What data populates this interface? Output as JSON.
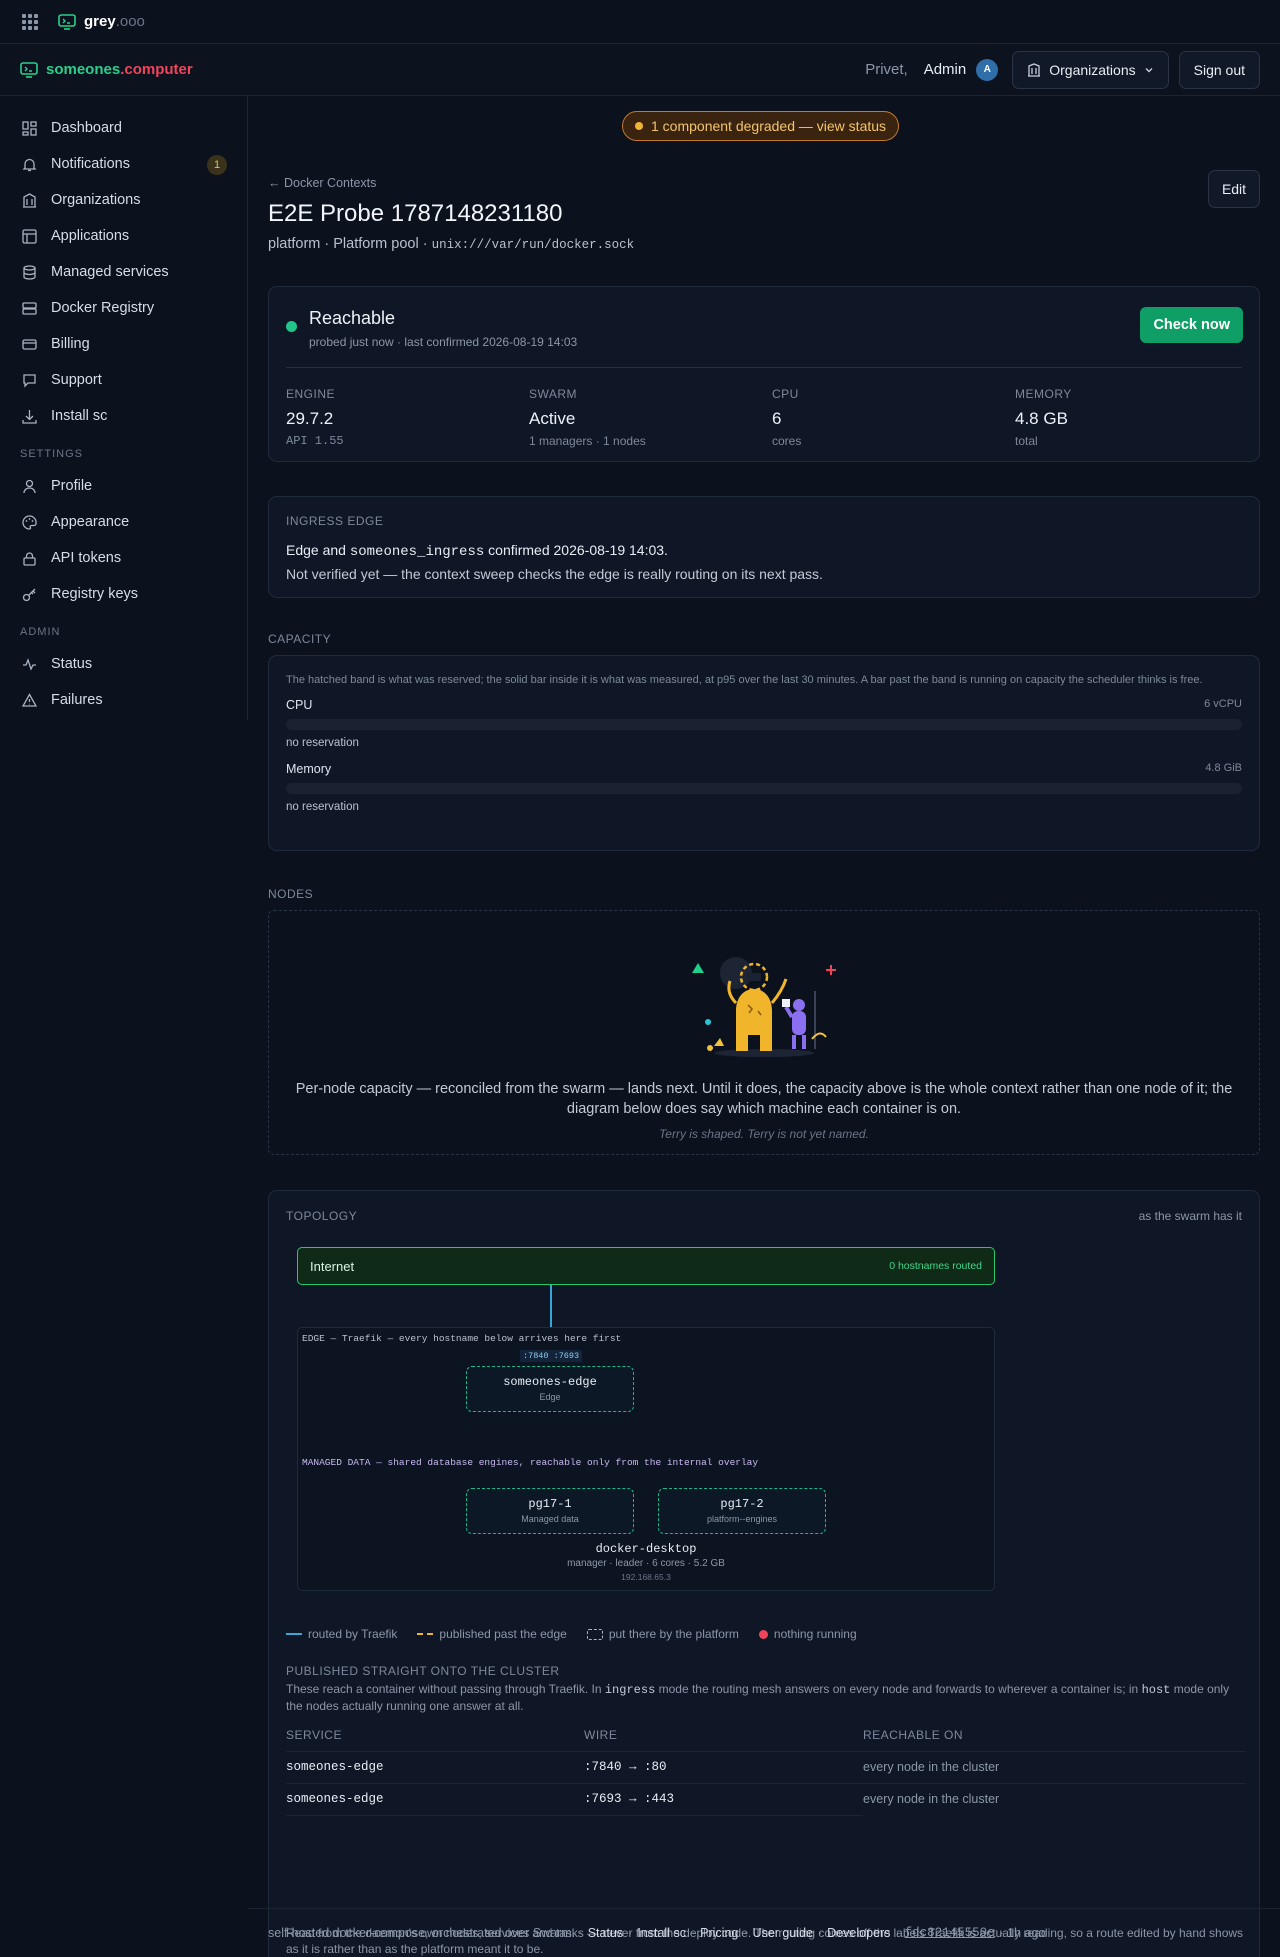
{
  "topbar": {
    "brand": "grey",
    "brand_suffix": ".ooo"
  },
  "header": {
    "brand_a": "someones",
    "brand_dot": ".",
    "brand_b": "computer",
    "greeting": "Privet,",
    "user": "Admin",
    "avatar_initial": "A",
    "org_button": "Organizations",
    "signout": "Sign out"
  },
  "sidebar": {
    "items": [
      {
        "label": "Dashboard",
        "icon": "dashboard-icon"
      },
      {
        "label": "Notifications",
        "icon": "bell-icon",
        "badge": "1"
      },
      {
        "label": "Organizations",
        "icon": "building-icon"
      },
      {
        "label": "Applications",
        "icon": "layout-icon"
      },
      {
        "label": "Managed services",
        "icon": "database-icon"
      },
      {
        "label": "Docker Registry",
        "icon": "server-icon"
      },
      {
        "label": "Billing",
        "icon": "card-icon"
      },
      {
        "label": "Support",
        "icon": "chat-icon"
      },
      {
        "label": "Install sc",
        "icon": "download-icon"
      }
    ],
    "settings_label": "SETTINGS",
    "settings": [
      {
        "label": "Profile",
        "icon": "user-icon"
      },
      {
        "label": "Appearance",
        "icon": "palette-icon"
      },
      {
        "label": "API tokens",
        "icon": "lock-icon"
      },
      {
        "label": "Registry keys",
        "icon": "key-icon"
      }
    ],
    "admin_label": "ADMIN",
    "admin": [
      {
        "label": "Status",
        "icon": "activity-icon"
      },
      {
        "label": "Failures",
        "icon": "warning-icon"
      }
    ]
  },
  "banner": "1 component degraded — view status",
  "page": {
    "breadcrumb": "← Docker Contexts",
    "title": "E2E Probe 1787148231180",
    "subtitle": "platform · Platform pool ·",
    "socket": "unix:///var/run/docker.sock",
    "edit": "Edit"
  },
  "status": {
    "state": "Reachable",
    "detail": "probed just now · last confirmed 2026-08-19 14:03",
    "check_button": "Check now",
    "stats": [
      {
        "label": "ENGINE",
        "value": "29.7.2",
        "sub": "API 1.55"
      },
      {
        "label": "SWARM",
        "value": "Active",
        "sub": "1 managers · 1 nodes"
      },
      {
        "label": "CPU",
        "value": "6",
        "sub": "cores"
      },
      {
        "label": "MEMORY",
        "value": "4.8 GB",
        "sub": "total"
      }
    ]
  },
  "ingress": {
    "label": "INGRESS EDGE",
    "line1_a": "Edge and",
    "line1_code": "someones_ingress",
    "line1_b": "confirmed 2026-08-19 14:03.",
    "line2": "Not verified yet — the context sweep checks the edge is really routing on its next pass."
  },
  "capacity": {
    "label": "CAPACITY",
    "note": "The hatched band is what was reserved; the solid bar inside it is what was measured, at p95 over the last 30 minutes. A bar past the band is running on capacity the scheduler thinks is free.",
    "rows": [
      {
        "name": "CPU",
        "total": "6 vCPU",
        "note": "no reservation"
      },
      {
        "name": "Memory",
        "total": "4.8 GiB",
        "note": "no reservation"
      }
    ]
  },
  "nodes": {
    "label": "NODES",
    "text": "Per-node capacity — reconciled from the swarm — lands next. Until it does, the capacity above is the whole context rather than one node of it; the diagram below does say which machine each container is on.",
    "caption": "Terry is shaped. Terry is not yet named."
  },
  "topology": {
    "label": "TOPOLOGY",
    "note": "as the swarm has it",
    "internet": "Internet",
    "hostnames": "0 hostnames routed",
    "edge_caption": "EDGE — Traefik — every hostname below arrives here first",
    "ports": ":7840 :7693",
    "edge_node": {
      "name": "someones-edge",
      "kind": "Edge"
    },
    "managed_caption": "MANAGED DATA — shared database engines, reachable only from the internal overlay",
    "managed_nodes": [
      {
        "name": "pg17-1",
        "kind": "Managed data"
      },
      {
        "name": "pg17-2",
        "kind": "platform--engines"
      }
    ],
    "host": {
      "name": "docker-desktop",
      "meta": "manager · leader · 6 cores · 5.2 GB",
      "ip": "192.168.65.3"
    },
    "legend": [
      "routed by Traefik",
      "published past the edge",
      "put there by the platform",
      "nothing running"
    ],
    "published_label": "PUBLISHED STRAIGHT ONTO THE CLUSTER",
    "published_text_a": "These reach a container without passing through Traefik. In",
    "published_code_a": "ingress",
    "published_text_b": "mode the routing mesh answers on every node and forwards to wherever a container is; in",
    "published_code_b": "host",
    "published_text_c": "mode only the nodes actually running one answer at all.",
    "table": {
      "headers": [
        "SERVICE",
        "WIRE",
        "REACHABLE ON"
      ],
      "rows": [
        [
          "someones-edge",
          ":7840 → :80",
          "every node in the cluster"
        ],
        [
          "someones-edge",
          ":7693 → :443",
          "every node in the cluster"
        ]
      ]
    },
    "footnote": "Read from the daemon's own nodes, services and tasks — never from the deploy code. The routing comes off the labels Traefik is actually reading, so a route edited by hand shows as it is rather than as the platform meant it to be."
  },
  "footer": {
    "text": "self-hosted docker-compose, orchestrated over Swarm. ·",
    "links": [
      "Status",
      "Install sc",
      "Pricing",
      "User guide",
      "Developers"
    ],
    "commit": "fdc82145550e",
    "ago": "· 1h ago"
  }
}
